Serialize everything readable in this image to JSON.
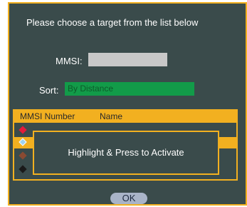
{
  "dialog": {
    "prompt": "Please choose a target from the list below",
    "mmsi": {
      "label": "MMSI:",
      "value": "",
      "placeholder": ""
    },
    "sort": {
      "label": "Sort:",
      "selected": "By Distance"
    },
    "list": {
      "columns": [
        "MMSI Number",
        "Name"
      ],
      "rows": [
        {
          "icon": "diamond-red-icon",
          "selected": false,
          "color": "#e21b3a"
        },
        {
          "icon": "diamond-lightblue-icon",
          "selected": true,
          "color": "#9fd3ef"
        },
        {
          "icon": "diamond-brown-icon",
          "selected": false,
          "color": "#8a4a32"
        },
        {
          "icon": "diamond-black-icon",
          "selected": false,
          "color": "#1a1a1a"
        }
      ]
    },
    "tooltip": "Highlight & Press to Activate",
    "ok_label": "OK"
  },
  "colors": {
    "background": "#3a4b4b",
    "accent": "#f2b020",
    "sort_field": "#129b49",
    "input_field": "#c8c8c8",
    "ok_button": "#a9b4c8"
  }
}
